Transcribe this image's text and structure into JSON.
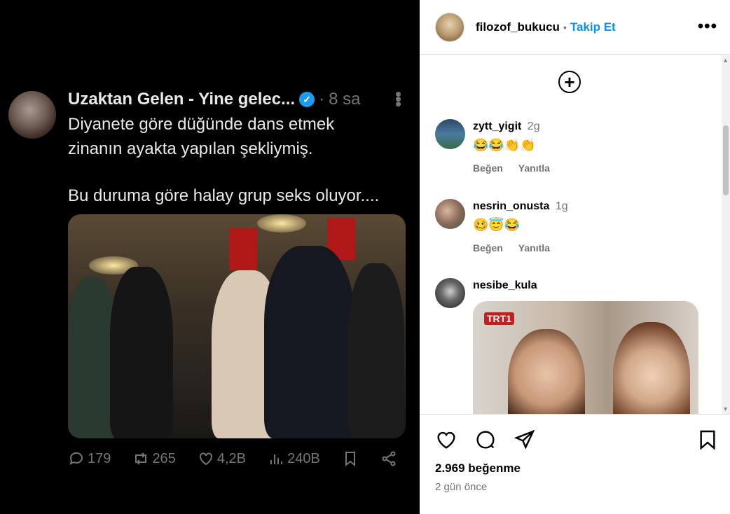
{
  "tweet": {
    "name": "Uzaktan Gelen - Yine gelec...",
    "verified_glyph": "✓",
    "dot": "·",
    "time": "8 sa",
    "line1": "Diyanete göre düğünde dans etmek",
    "line2": "zinanın ayakta yapılan şekliymiş.",
    "line3": "Bu duruma göre halay grup seks oluyor....",
    "replies": "179",
    "retweets": "265",
    "likes": "4,2B",
    "views": "240B"
  },
  "post": {
    "username": "filozof_bukucu",
    "dot": "•",
    "follow_label": "Takip Et",
    "more": "•••",
    "like_count": "2.969 beğenme",
    "age": "2 gün önce"
  },
  "comments": [
    {
      "user": "zytt_yigit",
      "time": "2g",
      "emoji": "😂😂👏👏",
      "like": "Beğen",
      "reply": "Yanıtla"
    },
    {
      "user": "nesrin_onusta",
      "time": "1g",
      "emoji": "🥴😇😂",
      "like": "Beğen",
      "reply": "Yanıtla"
    },
    {
      "user": "nesibe_kula",
      "gif_badge": "TRT1"
    }
  ],
  "icons": {
    "add": "add-circle-icon",
    "like": "heart-icon",
    "comment": "comment-icon",
    "share": "send-icon",
    "save": "bookmark-icon"
  },
  "colors": {
    "accent": "#0095f6",
    "tweet_bg": "#000000",
    "verified": "#1d9bf0"
  }
}
